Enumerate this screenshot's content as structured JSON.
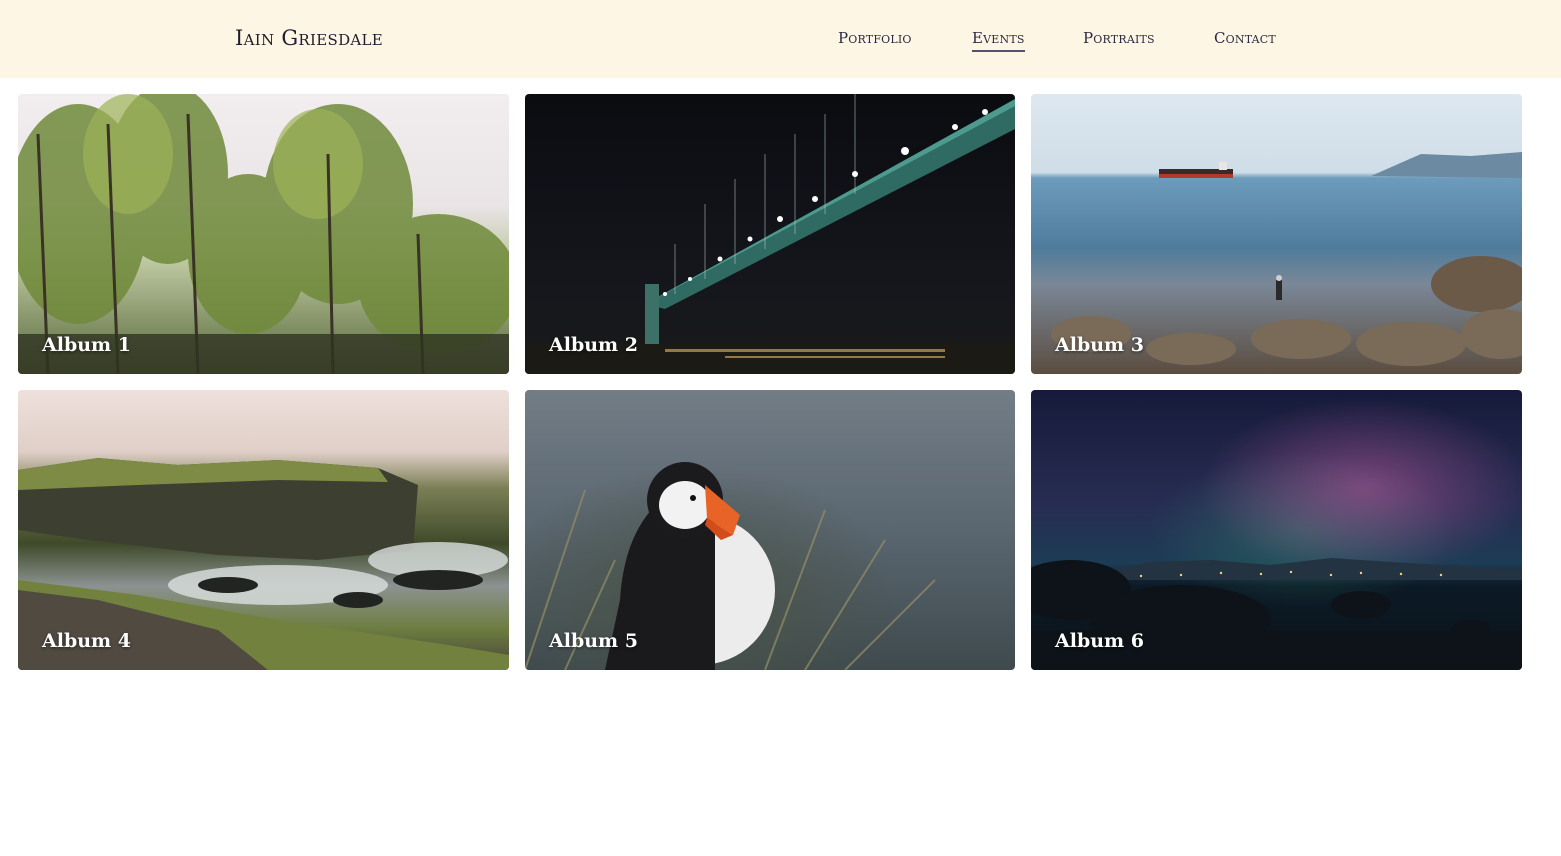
{
  "header": {
    "site_title": "Iain Griesdale",
    "nav": [
      {
        "label": "Portfolio",
        "active": false
      },
      {
        "label": "Events",
        "active": true
      },
      {
        "label": "Portraits",
        "active": false
      },
      {
        "label": "Contact",
        "active": false
      }
    ]
  },
  "albums": [
    {
      "label": "Album 1",
      "scene": "forest-trees"
    },
    {
      "label": "Album 2",
      "scene": "bridge-night"
    },
    {
      "label": "Album 3",
      "scene": "sea-ship-rocky-shore"
    },
    {
      "label": "Album 4",
      "scene": "coastal-cliffs"
    },
    {
      "label": "Album 5",
      "scene": "puffin"
    },
    {
      "label": "Album 6",
      "scene": "aurora-night-sky"
    }
  ],
  "colors": {
    "header_bg": "#fdf6e5",
    "text_dark": "#1f1e2e",
    "label_text": "#ffffff"
  }
}
